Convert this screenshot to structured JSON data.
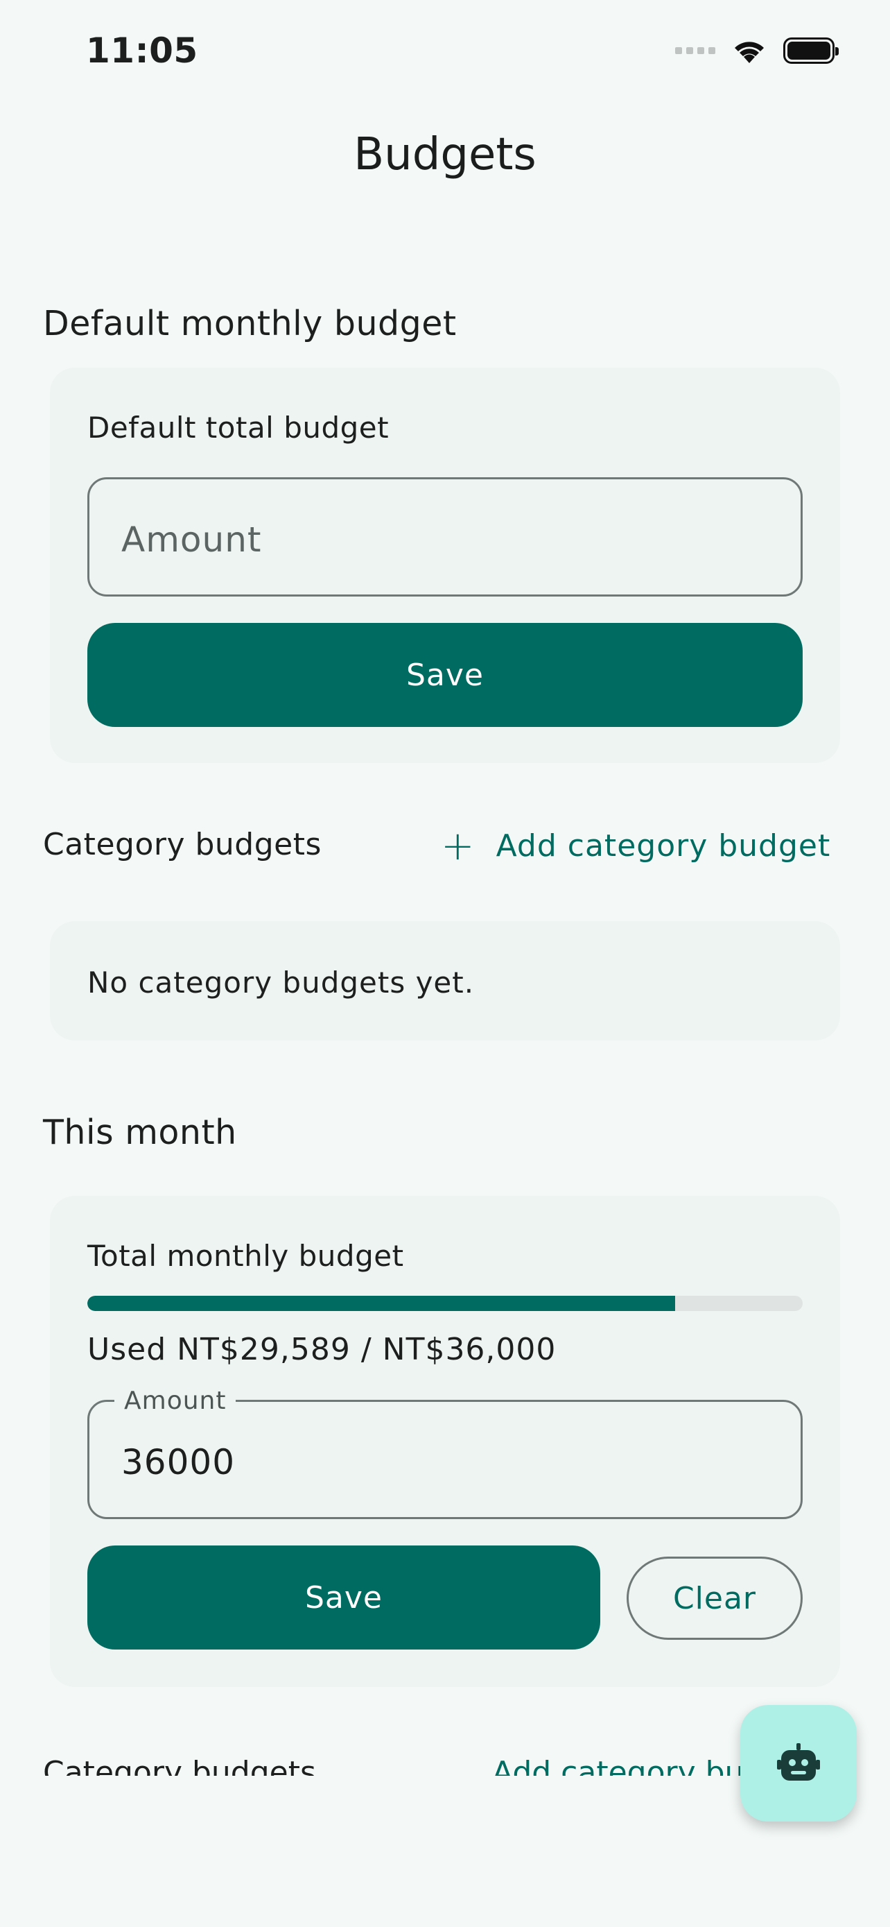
{
  "status_bar": {
    "time": "11:05"
  },
  "header": {
    "title": "Budgets"
  },
  "default_section": {
    "title": "Default monthly budget",
    "card_label": "Default total budget",
    "amount_placeholder": "Amount",
    "save_label": "Save"
  },
  "category_section": {
    "title": "Category budgets",
    "add_label": "Add category budget",
    "empty_text": "No category budgets yet."
  },
  "month_section": {
    "title": "This month",
    "card_label": "Total monthly budget",
    "progress_fraction": 0.822,
    "used_text": "Used NT$29,589 / NT$36,000",
    "amount_label": "Amount",
    "amount_value": "36000",
    "save_label": "Save",
    "clear_label": "Clear"
  },
  "cutoff_row": {
    "left": "Category budgets",
    "right": "Add category budget"
  },
  "fab": {
    "icon": "robot-icon"
  },
  "colors": {
    "primary": "#006b60",
    "background": "#f4f9f7",
    "card": "#eef4f2",
    "fab": "#aef0e6",
    "track": "#dfe4e3"
  }
}
